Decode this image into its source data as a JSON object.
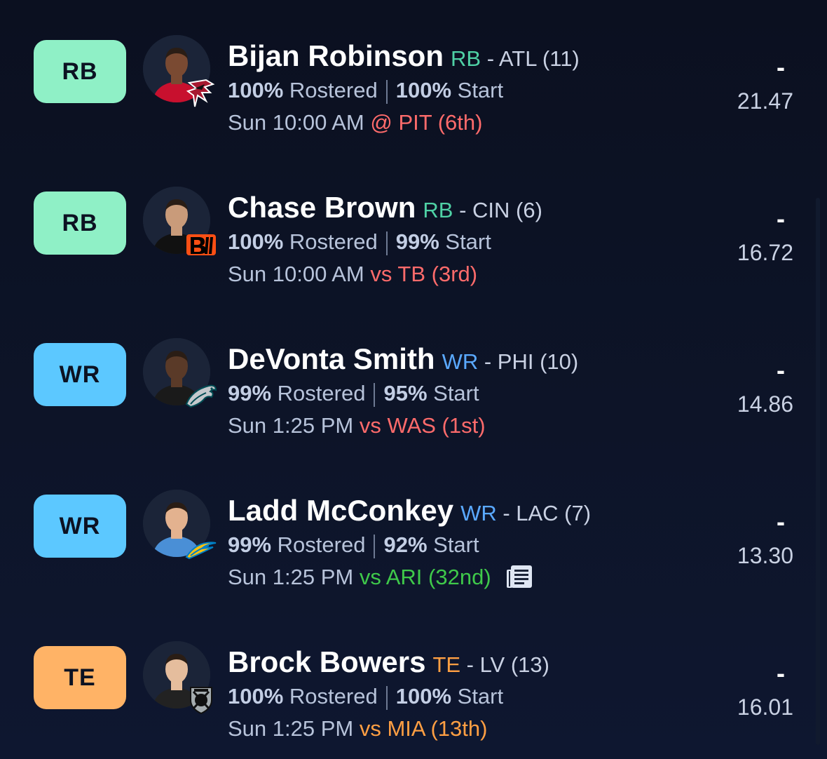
{
  "players": [
    {
      "position": "RB",
      "badge_color": "#8ff0c6",
      "name": "Bijan Robinson",
      "pos_tag": "RB",
      "pos_color": "#4fd1a5",
      "team_info": " - ATL (11)",
      "rostered_pct": "100%",
      "rostered_label": "Rostered",
      "start_pct": "100%",
      "start_label": "Start",
      "game_time": "Sun 10:00 AM",
      "matchup": "@ PIT (6th)",
      "matchup_color": "#ff6b6b",
      "points": "-",
      "projection": "21.47",
      "team_logo_icon": "falcons-logo-icon",
      "has_news": false
    },
    {
      "position": "RB",
      "badge_color": "#8ff0c6",
      "name": "Chase Brown",
      "pos_tag": "RB",
      "pos_color": "#4fd1a5",
      "team_info": " - CIN (6)",
      "rostered_pct": "100%",
      "rostered_label": "Rostered",
      "start_pct": "99%",
      "start_label": "Start",
      "game_time": "Sun 10:00 AM",
      "matchup": "vs TB (3rd)",
      "matchup_color": "#ff6b6b",
      "points": "-",
      "projection": "16.72",
      "team_logo_icon": "bengals-logo-icon",
      "has_news": false
    },
    {
      "position": "WR",
      "badge_color": "#5cc8ff",
      "name": "DeVonta Smith",
      "pos_tag": "WR",
      "pos_color": "#5aa9ff",
      "team_info": " - PHI (10)",
      "rostered_pct": "99%",
      "rostered_label": "Rostered",
      "start_pct": "95%",
      "start_label": "Start",
      "game_time": "Sun 1:25 PM",
      "matchup": "vs WAS (1st)",
      "matchup_color": "#ff6b6b",
      "points": "-",
      "projection": "14.86",
      "team_logo_icon": "eagles-logo-icon",
      "has_news": false
    },
    {
      "position": "WR",
      "badge_color": "#5cc8ff",
      "name": "Ladd McConkey",
      "pos_tag": "WR",
      "pos_color": "#5aa9ff",
      "team_info": " - LAC (7)",
      "rostered_pct": "99%",
      "rostered_label": "Rostered",
      "start_pct": "92%",
      "start_label": "Start",
      "game_time": "Sun 1:25 PM",
      "matchup": "vs ARI (32nd)",
      "matchup_color": "#3fc94a",
      "points": "-",
      "projection": "13.30",
      "team_logo_icon": "chargers-logo-icon",
      "has_news": true
    },
    {
      "position": "TE",
      "badge_color": "#ffb366",
      "name": "Brock Bowers",
      "pos_tag": "TE",
      "pos_color": "#ff9f43",
      "team_info": " - LV (13)",
      "rostered_pct": "100%",
      "rostered_label": "Rostered",
      "start_pct": "100%",
      "start_label": "Start",
      "game_time": "Sun 1:25 PM",
      "matchup": "vs MIA (13th)",
      "matchup_color": "#ff9f43",
      "points": "-",
      "projection": "16.01",
      "team_logo_icon": "raiders-logo-icon",
      "has_news": false
    }
  ]
}
